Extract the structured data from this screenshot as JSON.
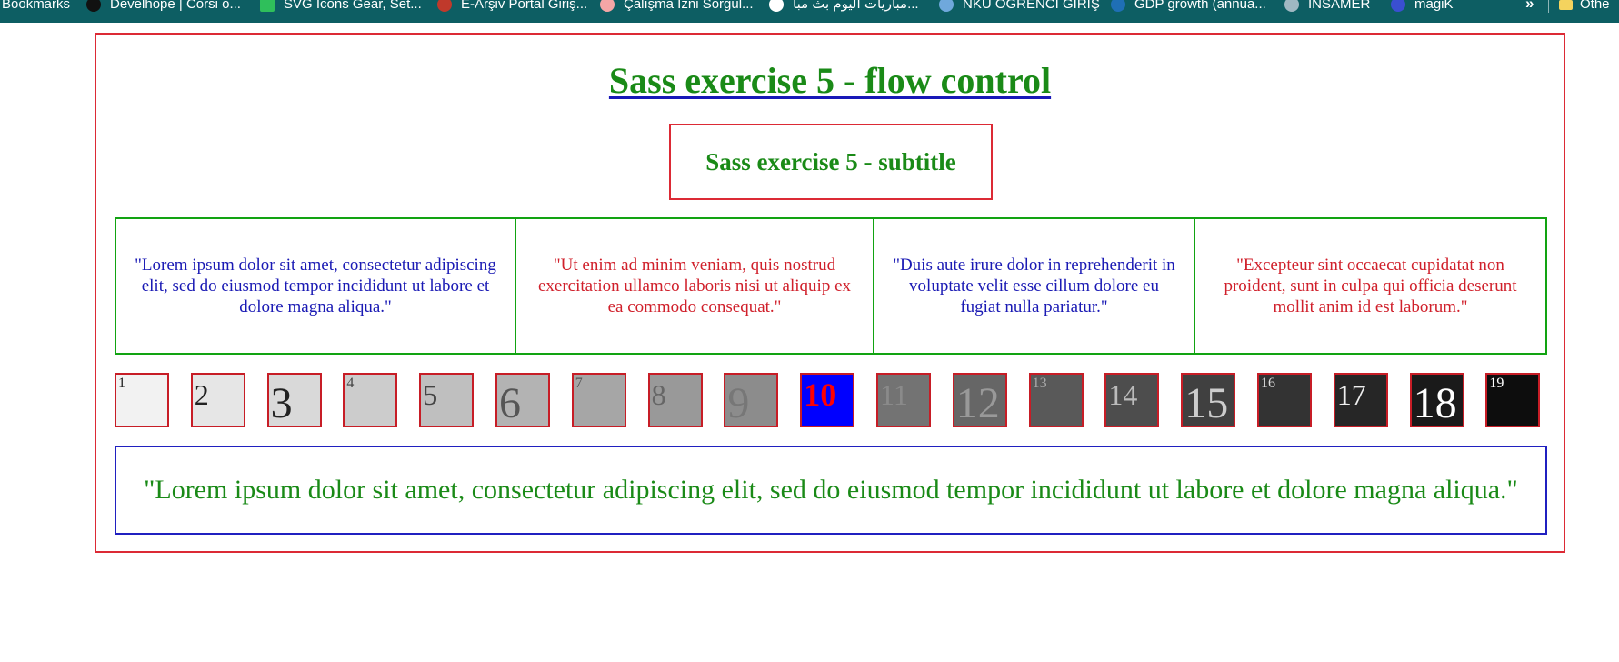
{
  "bookmarks_bar": {
    "items": [
      {
        "label": "Bookmarks",
        "icon": "",
        "color": ""
      },
      {
        "label": "Develhope | Corsi o...",
        "icon": "develhope-icon",
        "color": "#111111"
      },
      {
        "label": "SVG Icons Gear, Set...",
        "icon": "svg-icons-icon",
        "color": "#2fbf5b"
      },
      {
        "label": "E-Arşiv Portal Giriş...",
        "icon": "earsiv-icon",
        "color": "#c0392b"
      },
      {
        "label": "Çalışma İzni Sorgul...",
        "icon": "calisma-izni-icon",
        "color": "#f4a6a6"
      },
      {
        "label": "مباريات اليوم بث مبا...",
        "icon": "globe-icon",
        "color": "#ffffff"
      },
      {
        "label": "NKÜ ÖĞRENCİ GİRİŞ",
        "icon": "nku-icon",
        "color": "#6fa8dc"
      },
      {
        "label": "GDP growth (annua...",
        "icon": "worldbank-icon",
        "color": "#1f6fb5"
      },
      {
        "label": "İNSAMER",
        "icon": "insamer-icon",
        "color": "#9fb8c2"
      },
      {
        "label": "magiK",
        "icon": "magik-icon",
        "color": "#3a4fd1"
      }
    ],
    "more": "»",
    "other": "Othe"
  },
  "page": {
    "title": "Sass exercise 5 - flow control",
    "subtitle": "Sass exercise 5 - subtitle",
    "quotes": [
      {
        "text": "\"Lorem ipsum dolor sit amet, consectetur adipiscing elit, sed do eiusmod tempor incididunt ut labore et dolore magna aliqua.\"",
        "color": "#1a1ab4"
      },
      {
        "text": "\"Ut enim ad minim veniam, quis nostrud exercitation ullamco laboris nisi ut aliquip ex ea commodo consequat.\"",
        "color": "#d0202b"
      },
      {
        "text": "\"Duis aute irure dolor in reprehenderit in voluptate velit esse cillum dolore eu fugiat nulla pariatur.\"",
        "color": "#1a1ab4"
      },
      {
        "text": "\"Excepteur sint occaecat cupidatat non proident, sunt in culpa qui officia deserunt mollit anim id est laborum.\"",
        "color": "#d0202b"
      }
    ],
    "squares": [
      {
        "label": "1",
        "bg": "#f2f2f2",
        "color": "#222222"
      },
      {
        "label": "2",
        "bg": "#e6e6e6",
        "color": "#222222"
      },
      {
        "label": "3",
        "bg": "#d9d9d9",
        "color": "#222222"
      },
      {
        "label": "4",
        "bg": "#cccccc",
        "color": "#444444"
      },
      {
        "label": "5",
        "bg": "#bfbfbf",
        "color": "#444444"
      },
      {
        "label": "6",
        "bg": "#b3b3b3",
        "color": "#555555"
      },
      {
        "label": "7",
        "bg": "#a6a6a6",
        "color": "#555555"
      },
      {
        "label": "8",
        "bg": "#999999",
        "color": "#666666"
      },
      {
        "label": "9",
        "bg": "#8c8c8c",
        "color": "#777777"
      },
      {
        "label": "10",
        "bg": "#0000ff",
        "color": "#ff0000"
      },
      {
        "label": "11",
        "bg": "#737373",
        "color": "#8a8a8a"
      },
      {
        "label": "12",
        "bg": "#666666",
        "color": "#999999"
      },
      {
        "label": "13",
        "bg": "#595959",
        "color": "#aaaaaa"
      },
      {
        "label": "14",
        "bg": "#4d4d4d",
        "color": "#bbbbbb"
      },
      {
        "label": "15",
        "bg": "#404040",
        "color": "#cccccc"
      },
      {
        "label": "16",
        "bg": "#333333",
        "color": "#dddddd"
      },
      {
        "label": "17",
        "bg": "#262626",
        "color": "#eeeeee"
      },
      {
        "label": "18",
        "bg": "#1a1a1a",
        "color": "#ffffff"
      },
      {
        "label": "19",
        "bg": "#0d0d0d",
        "color": "#ffffff"
      }
    ],
    "bottom_text": "\"Lorem ipsum dolor sit amet, consectetur adipiscing elit, sed do eiusmod tempor incididunt ut labore et dolore magna aliqua.\""
  }
}
